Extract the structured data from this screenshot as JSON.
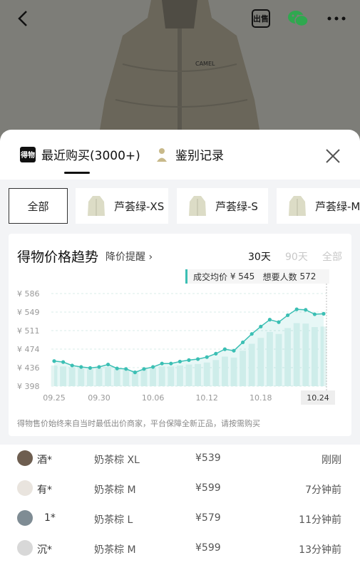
{
  "colors": {
    "accent": "#3bbfb4",
    "sheet_bg": "#ffffff",
    "band_bg": "#f3f4f6"
  },
  "top_bar": {
    "back_icon": "chevron-left-icon",
    "sell_label": "出售",
    "wechat_icon": "wechat-icon",
    "more_icon": "more-icon"
  },
  "sheet": {
    "tabs": [
      {
        "logo": "得物",
        "label": "最近购买(3000+)",
        "active": true
      },
      {
        "label": "鉴别记录",
        "active": false
      }
    ],
    "close_icon": "close-icon",
    "filters": [
      {
        "label": "全部",
        "active": true
      },
      {
        "label": "芦荟绿-XS",
        "active": false
      },
      {
        "label": "芦荟绿-S",
        "active": false
      },
      {
        "label": "芦荟绿-M",
        "active": false
      }
    ],
    "chart_card": {
      "title": "得物价格趋势",
      "remind": "降价提醒 ›",
      "ranges": [
        {
          "label": "30天",
          "state": "active"
        },
        {
          "label": "90天",
          "state": "disabled"
        },
        {
          "label": "全部",
          "state": "disabled"
        }
      ],
      "legend_avg_label": "成交均价",
      "legend_avg_value": "¥ 545",
      "legend_want_label": "想要人数",
      "legend_want_value": "572",
      "disclaimer": "得物售价始终来自当时最低出价商家，平台保障全新正品，请按需购买"
    },
    "purchases": [
      {
        "name": "酒*",
        "spec": "奶茶棕 XL",
        "price": "¥539",
        "time": "刚刚"
      },
      {
        "name": "有*",
        "spec": "奶茶棕 M",
        "price": "¥599",
        "time": "7分钟前"
      },
      {
        "name": "1*",
        "spec": "奶茶棕 L",
        "price": "¥579",
        "time": "11分钟前"
      },
      {
        "name": "沉*",
        "spec": "奶茶棕 M",
        "price": "¥599",
        "time": "13分钟前"
      }
    ]
  },
  "chart_data": {
    "type": "line",
    "title": "得物价格趋势",
    "y_ticks": [
      "¥ 586",
      "¥ 549",
      "¥ 511",
      "¥ 474",
      "¥ 436",
      "¥ 398"
    ],
    "ylim": [
      398,
      586
    ],
    "x_tick_labels": [
      "09.25",
      "09.30",
      "10.06",
      "10.12",
      "10.18",
      "10.24"
    ],
    "highlighted_x": "10.24",
    "series": [
      {
        "values": [
          449,
          447,
          440,
          437,
          435,
          437,
          442,
          434,
          433,
          426,
          433,
          437,
          444,
          444,
          448,
          451,
          453,
          457,
          464,
          473,
          470,
          487,
          504,
          519,
          533,
          528,
          542,
          554,
          553,
          544,
          545
        ]
      }
    ],
    "volume_bars": [
      440,
      438,
      436,
      434,
      433,
      435,
      437,
      433,
      432,
      430,
      432,
      434,
      438,
      438,
      440,
      442,
      443,
      446,
      451,
      458,
      456,
      470,
      484,
      496,
      508,
      504,
      516,
      526,
      525,
      518,
      519
    ],
    "grid": true
  }
}
